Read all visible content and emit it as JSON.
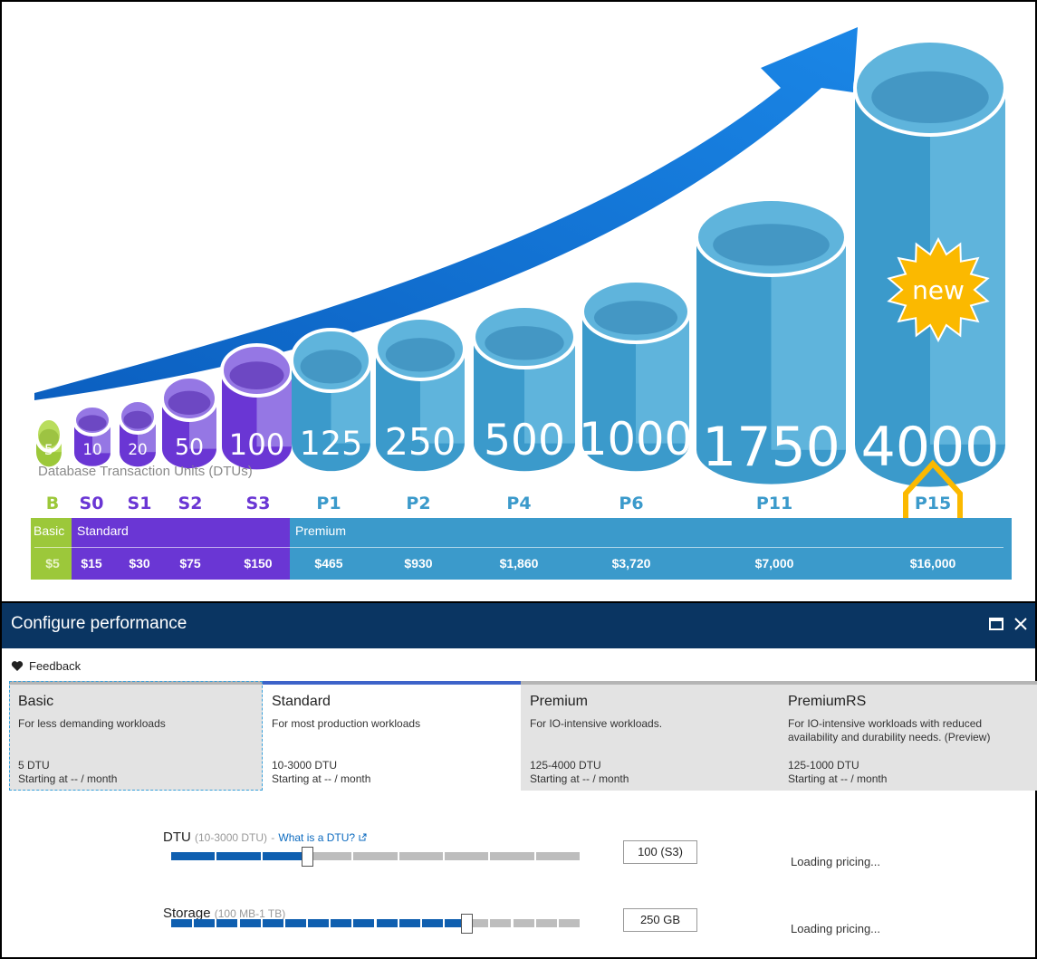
{
  "infographic": {
    "cylinders": [
      {
        "label": "5",
        "tier": "basic"
      },
      {
        "label": "10",
        "tier": "standard"
      },
      {
        "label": "20",
        "tier": "standard"
      },
      {
        "label": "50",
        "tier": "standard"
      },
      {
        "label": "100",
        "tier": "standard"
      },
      {
        "label": "125",
        "tier": "premium"
      },
      {
        "label": "250",
        "tier": "premium"
      },
      {
        "label": "500",
        "tier": "premium"
      },
      {
        "label": "1000",
        "tier": "premium"
      },
      {
        "label": "1750",
        "tier": "premium"
      },
      {
        "label": "4000",
        "tier": "premium"
      }
    ],
    "new_badge": "new",
    "caption": "Database Transaction Units (DTUs)",
    "codes": [
      "B",
      "S0",
      "S1",
      "S2",
      "S3",
      "P1",
      "P2",
      "P4",
      "P6",
      "P11",
      "P15"
    ],
    "bar_titles": {
      "basic": "Basic",
      "standard": "Standard",
      "premium": "Premium"
    },
    "prices": [
      "$5",
      "$15",
      "$30",
      "$75",
      "$150",
      "$465",
      "$930",
      "$1,860",
      "$3,720",
      "$7,000",
      "$16,000"
    ],
    "colors": {
      "basic": "#9cc83a",
      "standard": "#6a36d4",
      "premium": "#3b9acb",
      "arrow": "#0b6fd1",
      "badge": "#fbb900"
    }
  },
  "blade": {
    "title": "Configure performance",
    "maximize_icon": "maximize-icon",
    "close_icon": "close-icon",
    "feedback_label": "Feedback",
    "tiers": [
      {
        "name": "Basic",
        "description": "For less demanding workloads",
        "dtu": "5 DTU",
        "starting": "Starting at -- / month"
      },
      {
        "name": "Standard",
        "description": "For most production workloads",
        "dtu": "10-3000 DTU",
        "starting": "Starting at -- / month"
      },
      {
        "name": "Premium",
        "description": "For IO-intensive workloads.",
        "dtu": "125-4000 DTU",
        "starting": "Starting at -- / month"
      },
      {
        "name": "PremiumRS",
        "description": "For IO-intensive workloads with reduced availability and durability needs. (Preview)",
        "dtu": "125-1000 DTU",
        "starting": "Starting at -- / month"
      }
    ],
    "selected_tier": "Standard",
    "dtu": {
      "label": "DTU",
      "range": "(10-3000 DTU)",
      "separator": "-",
      "link": "What is a DTU?",
      "value": "100 (S3)",
      "pricing": "Loading pricing...",
      "segments": 9,
      "filled": 3
    },
    "storage": {
      "label": "Storage",
      "range": "(100 MB-1 TB)",
      "value": "250 GB",
      "pricing": "Loading pricing...",
      "segments": 18,
      "filled": 13
    }
  }
}
